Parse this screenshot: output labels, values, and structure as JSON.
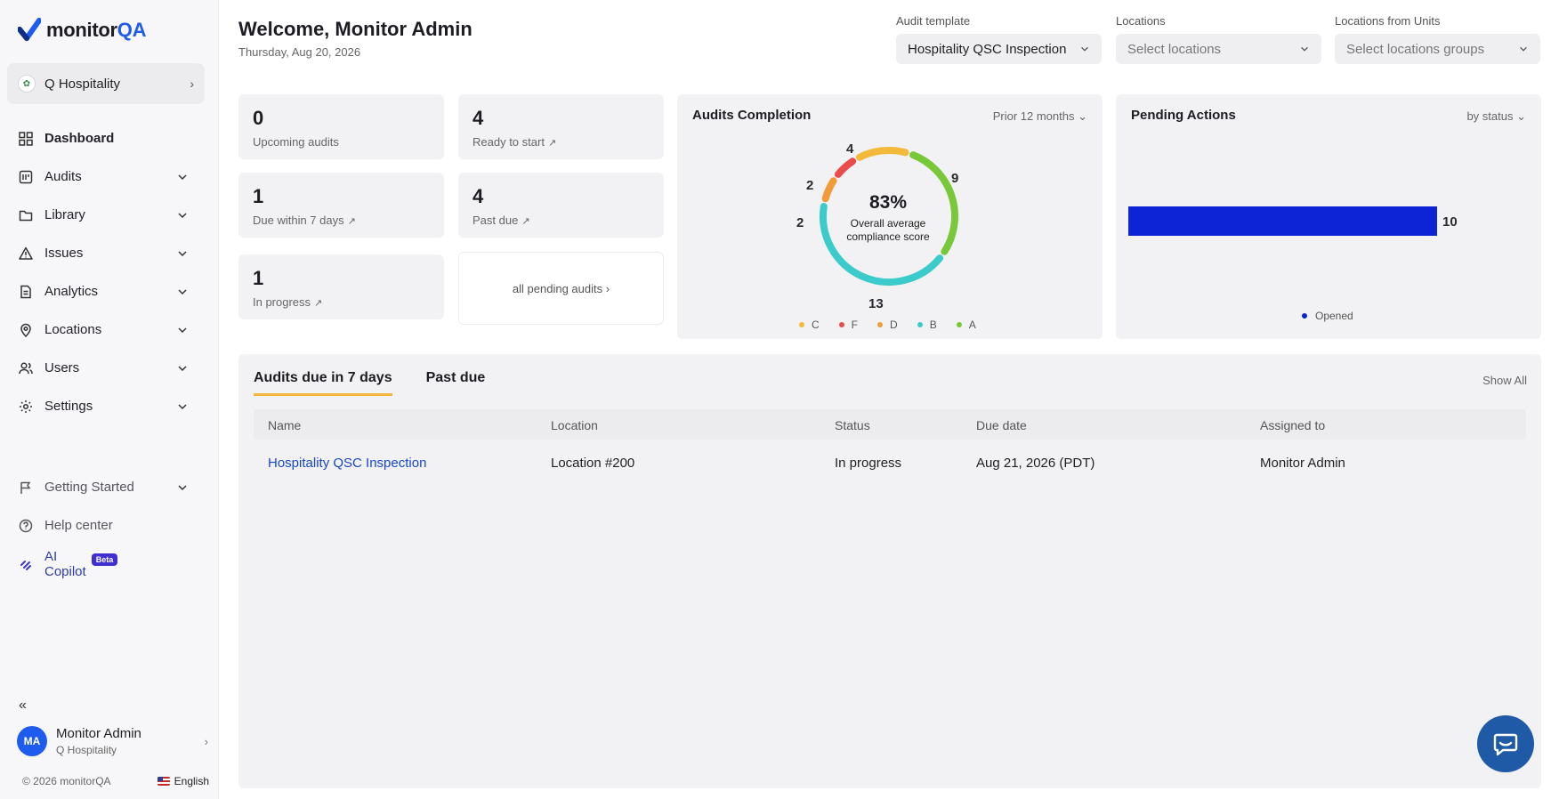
{
  "app": {
    "logo_text_1": "monitor",
    "logo_text_2": "QA"
  },
  "sidebar": {
    "org_name": "Q Hospitality",
    "items": [
      {
        "label": "Dashboard",
        "icon": "dashboard-icon"
      },
      {
        "label": "Audits",
        "icon": "audits-icon"
      },
      {
        "label": "Library",
        "icon": "folder-icon"
      },
      {
        "label": "Issues",
        "icon": "warning-icon"
      },
      {
        "label": "Analytics",
        "icon": "document-icon"
      },
      {
        "label": "Locations",
        "icon": "pin-icon"
      },
      {
        "label": "Users",
        "icon": "users-icon"
      },
      {
        "label": "Settings",
        "icon": "gear-icon"
      }
    ],
    "bottom_items": [
      {
        "label": "Getting Started",
        "icon": "flag-icon"
      },
      {
        "label": "Help center",
        "icon": "help-icon"
      },
      {
        "label": "AI Copilot",
        "icon": "ai-copilot-icon",
        "badge": "Beta"
      }
    ],
    "user": {
      "initials": "MA",
      "name": "Monitor Admin",
      "org": "Q Hospitality"
    },
    "copyright": "© 2026 monitorQA",
    "language": "English"
  },
  "header": {
    "welcome": "Welcome, Monitor Admin",
    "date": "Thursday, Aug 20, 2026",
    "filters": {
      "audit_template": {
        "label": "Audit template",
        "value": "Hospitality QSC Inspection"
      },
      "locations": {
        "label": "Locations",
        "placeholder": "Select locations"
      },
      "location_groups": {
        "label": "Locations from Units",
        "placeholder": "Select locations groups"
      }
    }
  },
  "stats": {
    "upcoming": {
      "value": "0",
      "label": "Upcoming audits"
    },
    "ready": {
      "value": "4",
      "label": "Ready to start"
    },
    "due7": {
      "value": "1",
      "label": "Due within 7 days"
    },
    "pastdue": {
      "value": "4",
      "label": "Past due"
    },
    "inprogress": {
      "value": "1",
      "label": "In progress"
    },
    "all_pending": "all pending audits ›"
  },
  "audits_completion": {
    "title": "Audits Completion",
    "period": "Prior 12 months",
    "percent": "83%",
    "caption_1": "Overall average",
    "caption_2": "compliance score"
  },
  "pending_actions": {
    "title": "Pending Actions",
    "group_by": "by status",
    "legend": "Opened"
  },
  "chart_data": [
    {
      "type": "pie",
      "title": "Audits Completion",
      "categories": [
        "C",
        "F",
        "D",
        "B",
        "A"
      ],
      "values": [
        4,
        2,
        2,
        13,
        9
      ],
      "colors": [
        "#f3b93b",
        "#ea4b4b",
        "#f29c38",
        "#3ccbcb",
        "#78c83a"
      ],
      "center_label": "83%"
    },
    {
      "type": "bar",
      "title": "Pending Actions",
      "orientation": "horizontal",
      "categories": [
        "Opened"
      ],
      "values": [
        10
      ],
      "colors": [
        "#0d24d6"
      ]
    }
  ],
  "table_section": {
    "tabs": [
      "Audits due in 7 days",
      "Past due"
    ],
    "show_all": "Show All",
    "columns": [
      "Name",
      "Location",
      "Status",
      "Due date",
      "Assigned to"
    ],
    "rows": [
      [
        "Hospitality QSC Inspection",
        "Location #200",
        "In progress",
        "Aug 21, 2026 (PDT)",
        "Monitor Admin"
      ]
    ]
  }
}
